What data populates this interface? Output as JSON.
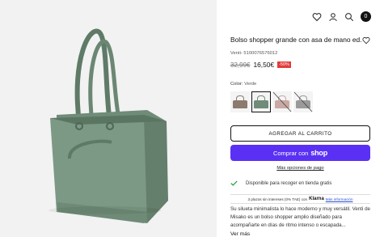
{
  "header": {
    "icons": [
      "heart-icon",
      "user-icon",
      "search-icon",
      "cart-icon"
    ],
    "cart_count": "0"
  },
  "product": {
    "title": "Bolso shopper grande con asa de mano ed.",
    "sku": "Venti- 5100076576012",
    "old_price": "32,99€",
    "new_price": "16,50€",
    "discount": "-50%",
    "color_label": "Color:",
    "color_value": "Verde",
    "swatches": [
      {
        "color": "#8c7a6e",
        "available": true,
        "selected": false
      },
      {
        "color": "#6f8c78",
        "available": true,
        "selected": true
      },
      {
        "color": "#c8a9a4",
        "available": false,
        "selected": false
      },
      {
        "color": "#9a9a9a",
        "available": false,
        "selected": false
      }
    ]
  },
  "actions": {
    "add_to_cart": "AGREGAR AL CARRITO",
    "shop_pay_prefix": "Comprar con",
    "shop_pay_brand": "shop",
    "more_payment": "Más opciones de pago"
  },
  "pickup": {
    "text": "Disponible para recoger en tienda gratis",
    "icon": "check-icon",
    "color": "#2ea44f"
  },
  "klarna": {
    "text": "3 plazos sin intereses (0% TAE) con",
    "brand": "Klarna",
    "more": "Más información"
  },
  "description": {
    "text": "Su silueta minimalista lo hace moderno y muy versátil. Venti de Misako es un bolso shopper amplio diseñado para acompañarte en días de ritmo intenso o escapada...",
    "see_more": "Ver más"
  },
  "colors": {
    "shop_purple": "#5a31f4",
    "discount_red": "#e23b3b",
    "bag_green": "#6f8c78"
  }
}
